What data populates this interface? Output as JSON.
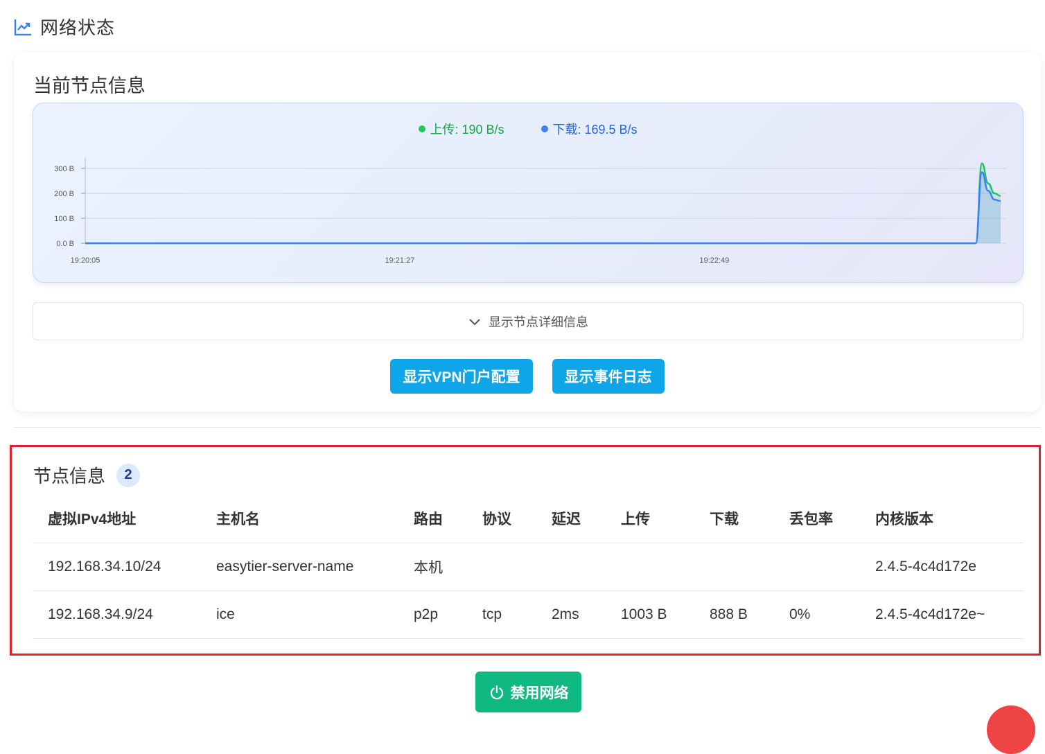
{
  "header": {
    "title": "网络状态",
    "icon": "trend-chart-icon"
  },
  "node_card": {
    "title": "当前节点信息",
    "legend": {
      "upload": "上传: 190 B/s",
      "download": "下载: 169.5 B/s"
    },
    "details_toggle": "显示节点详细信息",
    "buttons": {
      "vpn_portal": "显示VPN门户配置",
      "event_log": "显示事件日志"
    }
  },
  "chart_data": {
    "type": "area",
    "x": [
      "19:20:05",
      "19:21:27",
      "19:22:49"
    ],
    "y_ticks": [
      "0.0 B",
      "100 B",
      "200 B",
      "300 B"
    ],
    "ylim": [
      0,
      300
    ],
    "grid": true,
    "legend_placement": "top-center",
    "series": [
      {
        "name": "上传",
        "color": "#22c55e",
        "values": [
          0,
          0,
          0,
          0,
          0,
          0,
          0,
          0,
          0,
          0,
          0,
          0,
          0,
          0,
          0,
          0,
          0,
          0,
          0,
          0,
          320,
          240,
          200,
          190
        ]
      },
      {
        "name": "下载",
        "color": "#3b82f6",
        "values": [
          0,
          0,
          0,
          0,
          0,
          0,
          0,
          0,
          0,
          0,
          0,
          0,
          0,
          0,
          0,
          0,
          0,
          0,
          0,
          0,
          285,
          210,
          175,
          169.5
        ]
      }
    ]
  },
  "peers": {
    "title": "节点信息",
    "count": "2",
    "columns": [
      "虚拟IPv4地址",
      "主机名",
      "路由",
      "协议",
      "延迟",
      "上传",
      "下载",
      "丢包率",
      "内核版本"
    ],
    "rows": [
      [
        "192.168.34.10/24",
        "easytier-server-name",
        "本机",
        "",
        "",
        "",
        "",
        "",
        "2.4.5-4c4d172e"
      ],
      [
        "192.168.34.9/24",
        "ice",
        "p2p",
        "tcp",
        "2ms",
        "1003 B",
        "888 B",
        "0%",
        "2.4.5-4c4d172e~"
      ]
    ]
  },
  "disable_button": {
    "label": "禁用网络",
    "icon": "power-icon"
  },
  "colors": {
    "upload": "#22c55e",
    "download": "#3b82f6",
    "primary_button": "#0ea5e9",
    "disable_button": "#10b981",
    "highlight_border": "#e5202e"
  }
}
